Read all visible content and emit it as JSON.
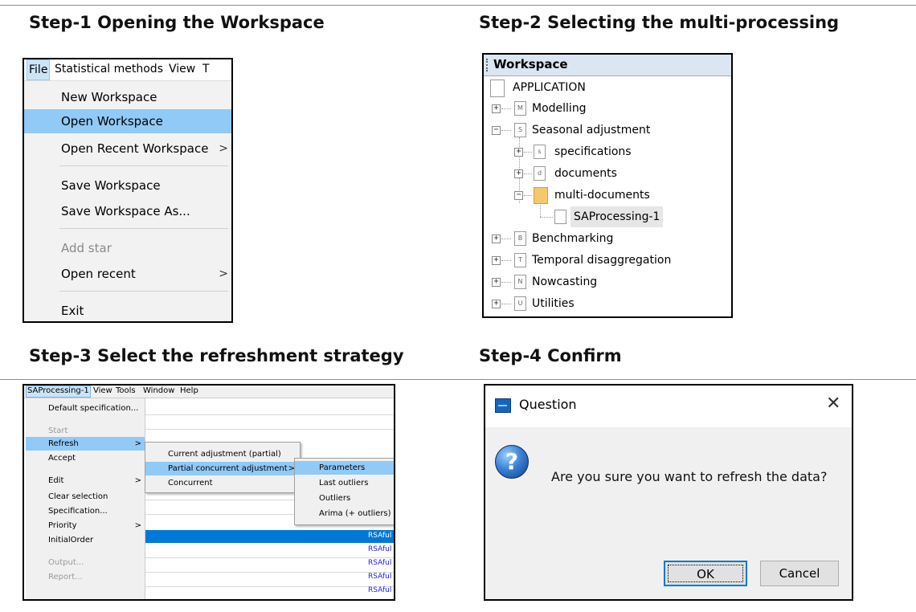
{
  "steps": {
    "s1": "Step-1 Opening the Workspace",
    "s2": "Step-2 Selecting the multi-processing",
    "s3": "Step-3 Select the refreshment strategy",
    "s4": "Step-4 Confirm"
  },
  "file_menu": {
    "menubar": [
      "File",
      "Statistical methods",
      "View",
      "T"
    ],
    "items": [
      {
        "label": "New Workspace"
      },
      {
        "label": "Open Workspace",
        "highlighted": true
      },
      {
        "label": "Open Recent Workspace",
        "submenu": true
      },
      {
        "label": "Save Workspace"
      },
      {
        "label": "Save Workspace As..."
      },
      {
        "label": "Add star",
        "disabled": true
      },
      {
        "label": "Open recent",
        "submenu": true
      },
      {
        "label": "Exit"
      }
    ],
    "arrow": ">"
  },
  "workspace": {
    "header": "Workspace",
    "root": "APPLICATION",
    "nodes": [
      {
        "label": "Modelling",
        "letter": "M"
      },
      {
        "label": "Seasonal adjustment",
        "letter": "S"
      },
      {
        "label": "specifications",
        "letter": "s"
      },
      {
        "label": "documents",
        "letter": "d"
      },
      {
        "label": "multi-documents"
      },
      {
        "label": "SAProcessing-1",
        "selected": true
      },
      {
        "label": "Benchmarking",
        "letter": "B"
      },
      {
        "label": "Temporal disaggregation",
        "letter": "T"
      },
      {
        "label": "Nowcasting",
        "letter": "N"
      },
      {
        "label": "Utilities",
        "letter": "U"
      }
    ],
    "expanders": {
      "plus": "+",
      "minus": "−"
    }
  },
  "sap_menu": {
    "menubar": [
      "SAProcessing-1",
      "View",
      "Tools",
      "Window",
      "Help"
    ],
    "items": [
      {
        "label": "Default specification..."
      },
      {
        "label": "Start",
        "disabled": true
      },
      {
        "label": "Refresh",
        "highlighted": true,
        "submenu": true
      },
      {
        "label": "Accept"
      },
      {
        "label": "Edit",
        "submenu": true
      },
      {
        "label": "Clear selection"
      },
      {
        "label": "Specification..."
      },
      {
        "label": "Priority",
        "submenu": true
      },
      {
        "label": "InitialOrder"
      },
      {
        "label": "Output...",
        "disabled": true
      },
      {
        "label": "Report...",
        "disabled": true
      }
    ],
    "refresh_submenu": [
      {
        "label": "Current adjustment (partial)"
      },
      {
        "label": "Partial concurrent adjustment",
        "highlighted": true,
        "submenu": true
      },
      {
        "label": "Concurrent"
      }
    ],
    "partial_submenu": [
      {
        "label": "Parameters",
        "highlighted": true
      },
      {
        "label": "Last outliers"
      },
      {
        "label": "Outliers"
      },
      {
        "label": "Arima (+ outliers)"
      }
    ],
    "table_cells": [
      "RSAful",
      "RSAful",
      "RSAful",
      "RSAful",
      "RSAful"
    ],
    "arrow": ">"
  },
  "dialog": {
    "title": "Question",
    "close": "✕",
    "icon": "?",
    "message": "Are you sure you want to refresh the data?",
    "ok": "OK",
    "cancel": "Cancel"
  },
  "colors": {
    "menu_highlight": "#91c9f7",
    "selection_blue": "#0078d7",
    "link_blue": "#1a1aff"
  }
}
